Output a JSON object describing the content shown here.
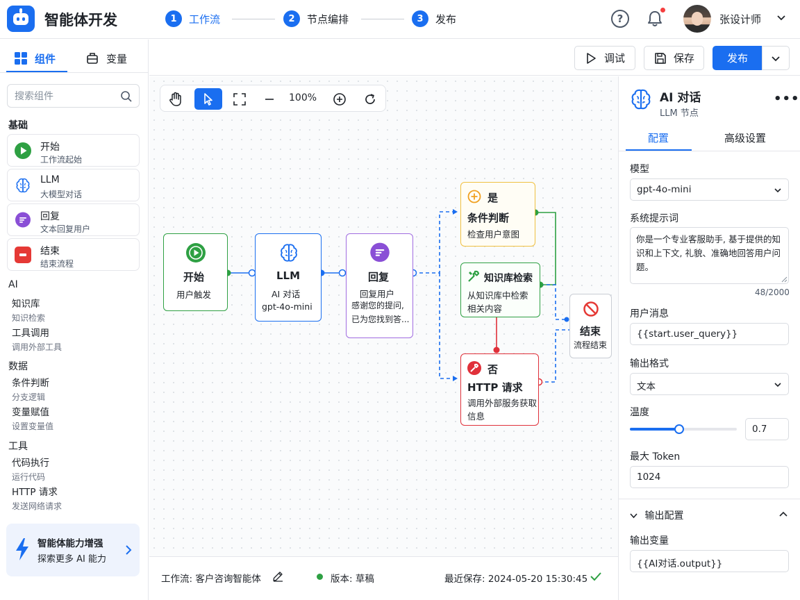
{
  "header": {
    "app_title": "智能体开发",
    "steps": [
      {
        "num": "1",
        "label": "工作流"
      },
      {
        "num": "2",
        "label": "节点编排"
      },
      {
        "num": "3",
        "label": "发布"
      }
    ],
    "help_glyph": "?",
    "user_name": "张设计师"
  },
  "sidebar": {
    "tabs": [
      {
        "label": "组件"
      },
      {
        "label": "变量"
      }
    ],
    "search_placeholder": "搜索组件",
    "groups": {
      "basic": "基础",
      "ai": "AI",
      "data": "数据",
      "tools": "工具"
    },
    "basic_items": [
      {
        "name": "开始",
        "desc": "工作流起始"
      },
      {
        "name": "LLM",
        "desc": "大模型对话"
      },
      {
        "name": "回复",
        "desc": "文本回复用户"
      },
      {
        "name": "结束",
        "desc": "结束流程"
      }
    ],
    "ai_items": [
      {
        "name": "知识库",
        "desc": "知识检索"
      },
      {
        "name": "工具调用",
        "desc": "调用外部工具"
      }
    ],
    "data_items": [
      {
        "name": "条件判断",
        "desc": "分支逻辑"
      },
      {
        "name": "变量赋值",
        "desc": "设置变量值"
      }
    ],
    "tool_items": [
      {
        "name": "代码执行",
        "desc": "运行代码"
      },
      {
        "name": "HTTP 请求",
        "desc": "发送网络请求"
      }
    ],
    "promo": {
      "title": "智能体能力增强",
      "subtitle": "探索更多 AI 能力"
    }
  },
  "toolbar": {
    "debug_label": "调试",
    "save_label": "保存",
    "publish_label": "发布"
  },
  "canvas": {
    "zoom": "100%",
    "nodes": {
      "start": {
        "title": "开始",
        "sub": "用户触发"
      },
      "llm": {
        "title": "LLM",
        "sub": "AI 对话",
        "model": "gpt-4o-mini"
      },
      "reply": {
        "title": "回复",
        "sub": "回复用户",
        "preview_1": "感谢您的提问,",
        "preview_2": "已为您找到答..."
      },
      "condition": {
        "badge": "是",
        "title": "条件判断",
        "sub": "检查用户意图"
      },
      "kb": {
        "title": "知识库检索",
        "sub_1": "从知识库中检索",
        "sub_2": "相关内容"
      },
      "http": {
        "badge": "否",
        "title": "HTTP 请求",
        "sub_1": "调用外部服务获取",
        "sub_2": "信息"
      },
      "end": {
        "title": "结束",
        "sub": "流程结束"
      }
    }
  },
  "status": {
    "workflow": "工作流: 客户咨询智能体",
    "version": "版本: 草稿",
    "saved": "最近保存: 2024-05-20 15:30:45"
  },
  "panel": {
    "title": "AI 对话",
    "subtitle": "LLM 节点",
    "more": "•••",
    "tabs": [
      {
        "label": "配置"
      },
      {
        "label": "高级设置"
      }
    ],
    "model_label": "模型",
    "model_value": "gpt-4o-mini",
    "system_prompt_label": "系统提示词",
    "system_prompt": "你是一个专业客服助手, 基于提供的知识和上下文, 礼貌、准确地回答用户问题。",
    "prompt_counter": "48/2000",
    "user_msg_label": "用户消息",
    "user_msg_value": "{{start.user_query}}",
    "output_format_label": "输出格式",
    "output_format_value": "文本",
    "temperature_label": "温度",
    "temperature_value": "0.7",
    "temperature_fraction": 0.46,
    "max_token_label": "最大 Token",
    "max_token_value": "1024",
    "output_section_label": "输出配置",
    "output_var_label": "输出变量",
    "output_var_value": "{{AI对话.output}}"
  },
  "colors": {
    "accent": "#1a6ef0",
    "start": "#2ea043",
    "reply": "#8a4fd6",
    "condition": "#f0a020",
    "http": "#e0303a",
    "end": "#e53935"
  }
}
